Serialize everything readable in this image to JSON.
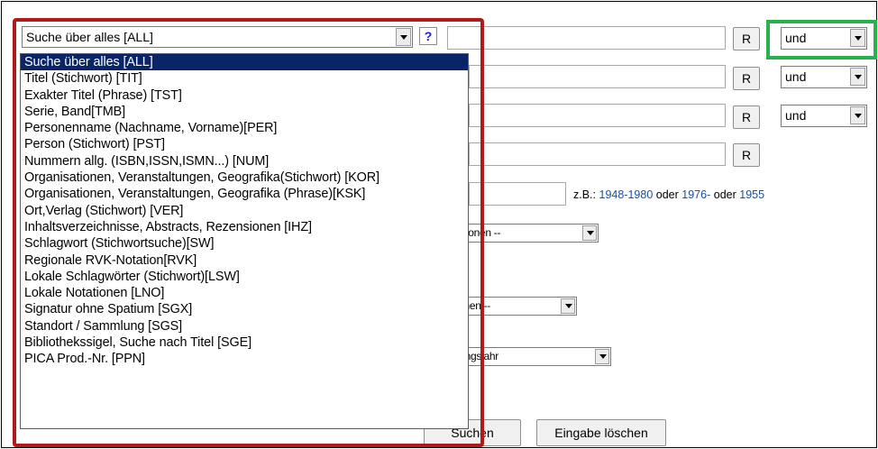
{
  "search_field": {
    "selected": "Suche über alles [ALL]",
    "help_label": "?"
  },
  "dropdown_options": [
    "Suche über alles [ALL]",
    "Titel (Stichwort) [TIT]",
    "Exakter Titel (Phrase) [TST]",
    "Serie, Band[TMB]",
    "Personenname (Nachname, Vorname)[PER]",
    "Person (Stichwort) [PST]",
    "Nummern allg. (ISBN,ISSN,ISMN...) [NUM]",
    "Organisationen, Veranstaltungen, Geografika(Stichwort) [KOR]",
    "Organisationen, Veranstaltungen, Geografika (Phrase)[KSK]",
    "Ort,Verlag (Stichwort) [VER]",
    "Inhaltsverzeichnisse, Abstracts, Rezensionen [IHZ]",
    "Schlagwort (Stichwortsuche)[SW]",
    "Regionale RVK-Notation[RVK]",
    "Lokale Schlagwörter (Stichwort)[LSW]",
    "Lokale Notationen [LNO]",
    "Signatur ohne Spatium [SGX]",
    "Standort / Sammlung [SGS]",
    "Bibliothekssigel, Suche nach Titel [SGE]",
    "PICA Prod.-Nr. [PPN]"
  ],
  "rows": [
    {
      "reset_label": "R",
      "operator": "und"
    },
    {
      "reset_label": "R",
      "operator": "und"
    },
    {
      "reset_label": "R",
      "operator": "und"
    },
    {
      "reset_label": "R"
    }
  ],
  "year_hint": {
    "prefix": "z.B.:",
    "ex1": "1948-1980",
    "or1": "oder",
    "ex2": "1976-",
    "or2": "oder",
    "ex3": "1955"
  },
  "filters": {
    "publication_type": "-- Alle Publikationen --",
    "language": "-- Alle Sprachen --",
    "sort": "Erscheinungsjahr"
  },
  "buttons": {
    "search": "Suchen",
    "clear": "Eingabe löschen"
  },
  "highlight_colors": {
    "red": "#b11a1a",
    "green": "#2bb14c"
  }
}
